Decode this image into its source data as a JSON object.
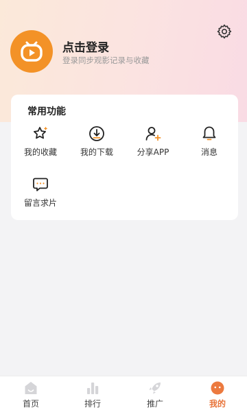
{
  "header": {
    "login_title": "点击登录",
    "login_subtitle": "登录同步观影记录与收藏",
    "settings_icon": "gear-icon",
    "logo_icon": "tv-play-logo"
  },
  "functions": {
    "section_title": "常用功能",
    "items": [
      {
        "label": "我的收藏",
        "icon": "star-icon"
      },
      {
        "label": "我的下载",
        "icon": "download-icon"
      },
      {
        "label": "分享APP",
        "icon": "user-plus-icon"
      },
      {
        "label": "消息",
        "icon": "bell-icon"
      },
      {
        "label": "留言求片",
        "icon": "message-icon"
      }
    ]
  },
  "tabbar": {
    "items": [
      {
        "label": "首页",
        "icon": "home-icon"
      },
      {
        "label": "排行",
        "icon": "bar-chart-icon"
      },
      {
        "label": "推广",
        "icon": "rocket-icon"
      },
      {
        "label": "我的",
        "icon": "face-icon",
        "active": true
      }
    ],
    "active_color": "#e8743a"
  },
  "colors": {
    "brand_orange": "#f39227"
  }
}
